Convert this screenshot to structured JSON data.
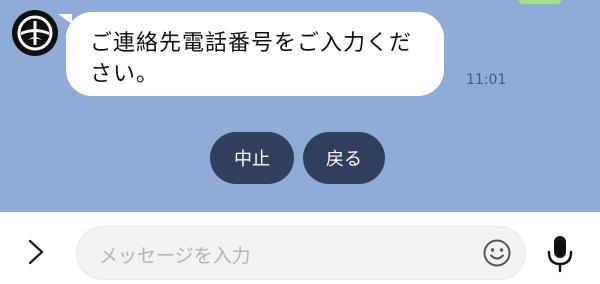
{
  "chat": {
    "avatar_icon": "company-logo-icon",
    "message": {
      "text": "ご連絡先電話番号をご入力ください。",
      "time": "11:01"
    },
    "quick_replies": [
      {
        "label": "中止"
      },
      {
        "label": "戻る"
      }
    ]
  },
  "input_bar": {
    "expand_icon": "chevron-right-icon",
    "placeholder": "メッセージを入力",
    "emoji_icon": "smiley-icon",
    "mic_icon": "microphone-icon"
  },
  "colors": {
    "chat_background": "#8fabd8",
    "bubble": "#ffffff",
    "quick_reply_button": "#2f3f5c",
    "input_field": "#f2f2f4"
  }
}
